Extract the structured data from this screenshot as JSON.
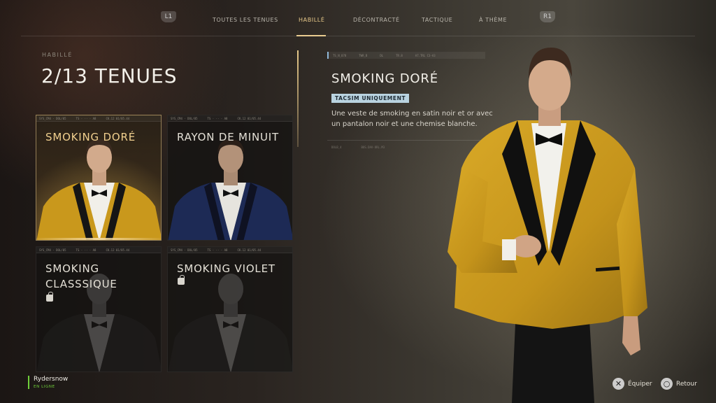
{
  "nav": {
    "left_button": "L1",
    "right_button": "R1",
    "tabs": [
      {
        "label": "TOUTES LES TENUES"
      },
      {
        "label": "HABILLÉ"
      },
      {
        "label": "DÉCONTRACTÉ"
      },
      {
        "label": "TACTIQUE"
      },
      {
        "label": "À THÈME"
      }
    ],
    "active_tab": "HABILLÉ"
  },
  "section": {
    "label": "HABILLÉ",
    "title": "2/13 TENUES"
  },
  "cards": [
    {
      "name": "SMOKING DORÉ",
      "selected": true,
      "locked": false,
      "suit_color": "#c9981c",
      "meta": [
        "SYS_CM4 · DOL/05",
        "TS · ·· · A8",
        "CK.12 01/05.44"
      ]
    },
    {
      "name": "RAYON DE MINUIT",
      "selected": false,
      "locked": false,
      "suit_color": "#1d2a55",
      "meta": [
        "SYS_CM4 · DOL/05",
        "TS · ·· · A8",
        "CK.12 01/05.44"
      ]
    },
    {
      "name": "SMOKING CLASSSIQUE",
      "selected": false,
      "locked": true,
      "suit_color": "#1a1a1a",
      "meta": [
        "SYS_CM4 · DOL/05",
        "TS · ·· · A8",
        "CK.12 01/05.44"
      ]
    },
    {
      "name": "SMOKING VIOLET",
      "selected": false,
      "locked": true,
      "suit_color": "#1a1a1a",
      "meta": [
        "SYS_CM4 · DOL/05",
        "TS · ·· · A8",
        "CK.12 01/05.44"
      ]
    }
  ],
  "detail": {
    "meta": [
      "TS_N_078",
      "TWR_B",
      "DL",
      "TR.8",
      "A7.TRL C3-A3"
    ],
    "title": "SMOKING DORÉ",
    "tag": "TACSIM UNIQUEMENT",
    "description": "Une veste de smoking en satin noir et or avec un pantalon noir et une chemise blanche.",
    "foot": [
      "DOLB_4",
      "BOS.DAV-ORL.M3"
    ]
  },
  "player": {
    "name": "Rydersnow",
    "status": "EN LIGNE"
  },
  "hints": {
    "equip_label": "Équiper",
    "back_label": "Retour"
  },
  "colors": {
    "accent_gold": "#e8c98a",
    "tag_bg": "#b9d3e0",
    "online_green": "#6fcf3a"
  }
}
